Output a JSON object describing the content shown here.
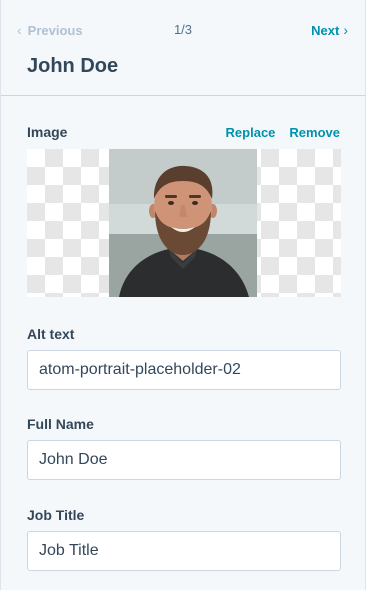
{
  "pager": {
    "previous_label": "Previous",
    "count": "1/3",
    "next_label": "Next"
  },
  "record": {
    "title": "John Doe"
  },
  "image_field": {
    "label": "Image",
    "replace_label": "Replace",
    "remove_label": "Remove"
  },
  "alt_text_field": {
    "label": "Alt text",
    "value": "atom-portrait-placeholder-02"
  },
  "full_name_field": {
    "label": "Full Name",
    "value": "John Doe"
  },
  "job_title_field": {
    "label": "Job Title",
    "value": "",
    "placeholder": "Job Title"
  },
  "colors": {
    "accent": "#0091ae",
    "text": "#33475b",
    "disabled": "#b0c1d4",
    "background": "#f5f8fa",
    "border": "#cbd6e2"
  },
  "icons": {
    "previous": "chevron-left-icon",
    "next": "chevron-right-icon"
  }
}
